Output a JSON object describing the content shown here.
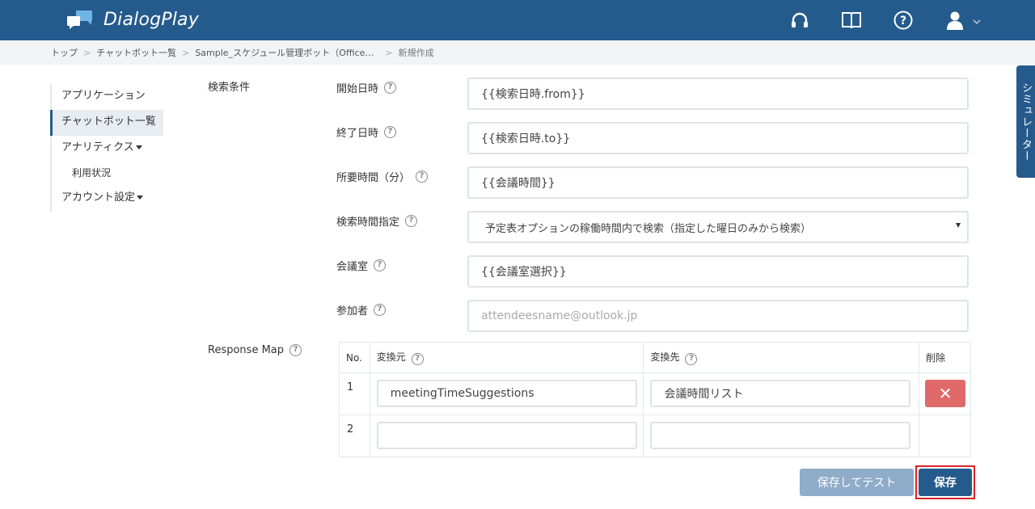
{
  "app": {
    "name": "DialogPlay"
  },
  "colors": {
    "primary": "#255b8c",
    "danger": "#e06a6a",
    "highlight_border": "#d92226"
  },
  "header": {
    "icons": [
      "headset-icon",
      "book-icon",
      "help-icon",
      "user-icon",
      "chevron-down-icon"
    ]
  },
  "breadcrumb": {
    "items": [
      "トップ",
      "チャットボット一覧",
      "Sample_スケジュール管理ボット（Office…",
      "新規作成"
    ],
    "separator": ">"
  },
  "sidebar": {
    "items": [
      {
        "label": "アプリケーション"
      },
      {
        "label": "チャットボット一覧"
      },
      {
        "label": "アナリティクス"
      },
      {
        "label": "利用状況"
      },
      {
        "label": "アカウント設定"
      }
    ]
  },
  "form": {
    "section_label": "検索条件",
    "fields": [
      {
        "label": "開始日時",
        "value": "{{検索日時.from}}"
      },
      {
        "label": "終了日時",
        "value": "{{検索日時.to}}"
      },
      {
        "label": "所要時間（分）",
        "value": "{{会議時間}}"
      },
      {
        "label": "検索時間指定",
        "value": "予定表オプションの稼働時間内で検索（指定した曜日のみから検索）"
      },
      {
        "label": "会議室",
        "value": "{{会議室選択}}"
      },
      {
        "label": "参加者",
        "placeholder": "attendeesname@outlook.jp"
      }
    ],
    "help_glyph": "?"
  },
  "response_map": {
    "label": "Response Map",
    "headers": {
      "no": "No.",
      "source": "変換元",
      "target": "変換先",
      "delete": "削除"
    },
    "rows": [
      {
        "no": "1",
        "source": "meetingTimeSuggestions",
        "target": "会議時間リスト",
        "delete_glyph": "✕"
      },
      {
        "no": "2",
        "source": "",
        "target": ""
      }
    ]
  },
  "buttons": {
    "save_and_test": "保存してテスト",
    "save": "保存"
  },
  "simulator_tab": {
    "label": "シミュレーター"
  }
}
